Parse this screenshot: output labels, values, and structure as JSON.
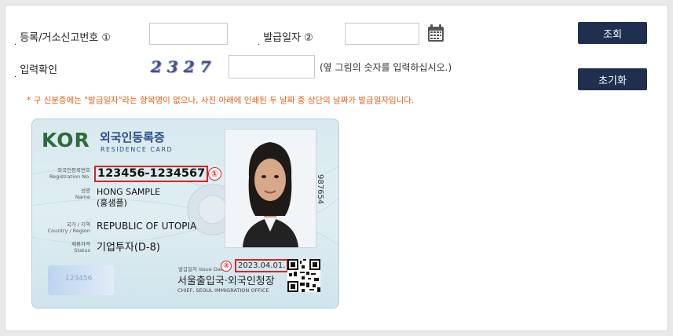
{
  "form": {
    "reg_label": "등록/거소신고번호",
    "reg_marker": "①",
    "issue_label": "발급일자",
    "issue_marker": "②",
    "captcha_label": "입력확인",
    "captcha_chars": [
      "2",
      "3",
      "2",
      "7"
    ],
    "captcha_hint": "(옆 그림의 숫자를 입력하십시오.)",
    "reg_value": "",
    "issue_value": "",
    "captcha_value": ""
  },
  "buttons": {
    "search": "조회",
    "reset": "초기화"
  },
  "note": "* 구 신분증에는 \"발급일자\"라는 항목명이 없으나, 사진 아래에 인쇄된 두 날짜 중 상단의 날짜가 발급일자입니다.",
  "icons": {
    "calendar": "calendar-icon"
  },
  "colors": {
    "button_bg": "#1f2f50",
    "note_text": "#e06018",
    "highlight": "#dd2222"
  },
  "card": {
    "country": "KOR",
    "title": "외국인등록증",
    "subtitle": "RESIDENCE CARD",
    "reg_label_ko": "외국인등록번호",
    "reg_label_en": "Registration No.",
    "reg_number": "123456-1234567",
    "marker1": "①",
    "name_label_ko": "성명",
    "name_label_en": "Name",
    "name_en": "HONG SAMPLE",
    "name_ko": "(홍샘플)",
    "country_label_ko": "국가 / 지역",
    "country_label_en": "Country / Region",
    "country_value": "REPUBLIC OF UTOPIA",
    "status_label_ko": "체류자격",
    "status_label_en": "Status",
    "status_value": "기업투자(D-8)",
    "serial": "987654",
    "issue_label": "발급일자 Issue Date",
    "marker2": "②",
    "issue_date": "2023.04.01.",
    "office": "서울출입국·외국인청장",
    "office_en": "CHIEF, SEOUL IMMIGRATION OFFICE",
    "mini_number": "123456"
  }
}
